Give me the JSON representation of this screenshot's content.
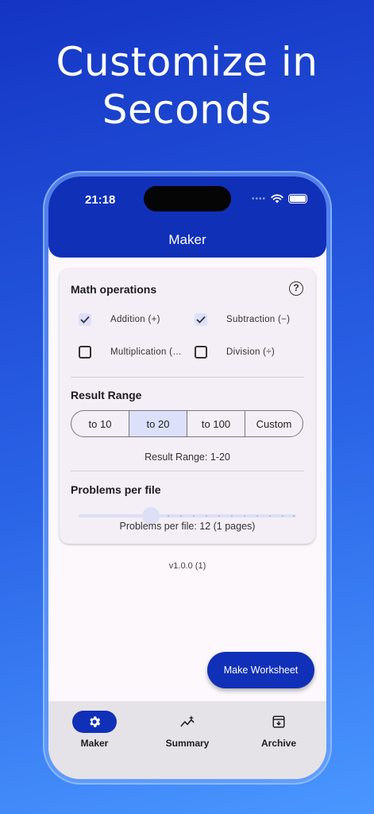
{
  "headline": {
    "line1": "Customize in",
    "line2": "Seconds"
  },
  "status_bar": {
    "time": "21:18"
  },
  "app_bar": {
    "title": "Maker"
  },
  "math_operations": {
    "title": "Math operations",
    "options": [
      {
        "label": "Addition (+)",
        "checked": true
      },
      {
        "label": "Subtraction (−)",
        "checked": true
      },
      {
        "label": "Multiplication (…",
        "checked": false
      },
      {
        "label": "Division (÷)",
        "checked": false
      }
    ]
  },
  "result_range": {
    "title": "Result Range",
    "segments": [
      "to 10",
      "to 20",
      "to 100",
      "Custom"
    ],
    "selected_index": 1,
    "caption": "Result Range: 1-20"
  },
  "problems_per_file": {
    "title": "Problems per file",
    "value": 12,
    "caption": "Problems per file: 12 (1 pages)"
  },
  "version": "v1.0.0 (1)",
  "fab": {
    "label": "Make Worksheet"
  },
  "nav": {
    "items": [
      {
        "label": "Maker",
        "icon": "gear-icon",
        "active": true
      },
      {
        "label": "Summary",
        "icon": "chart-sparkle-icon",
        "active": false
      },
      {
        "label": "Archive",
        "icon": "archive-icon",
        "active": false
      }
    ]
  },
  "colors": {
    "primary": "#1030b8",
    "selected": "#dce0fb",
    "card": "#f4eff6"
  }
}
